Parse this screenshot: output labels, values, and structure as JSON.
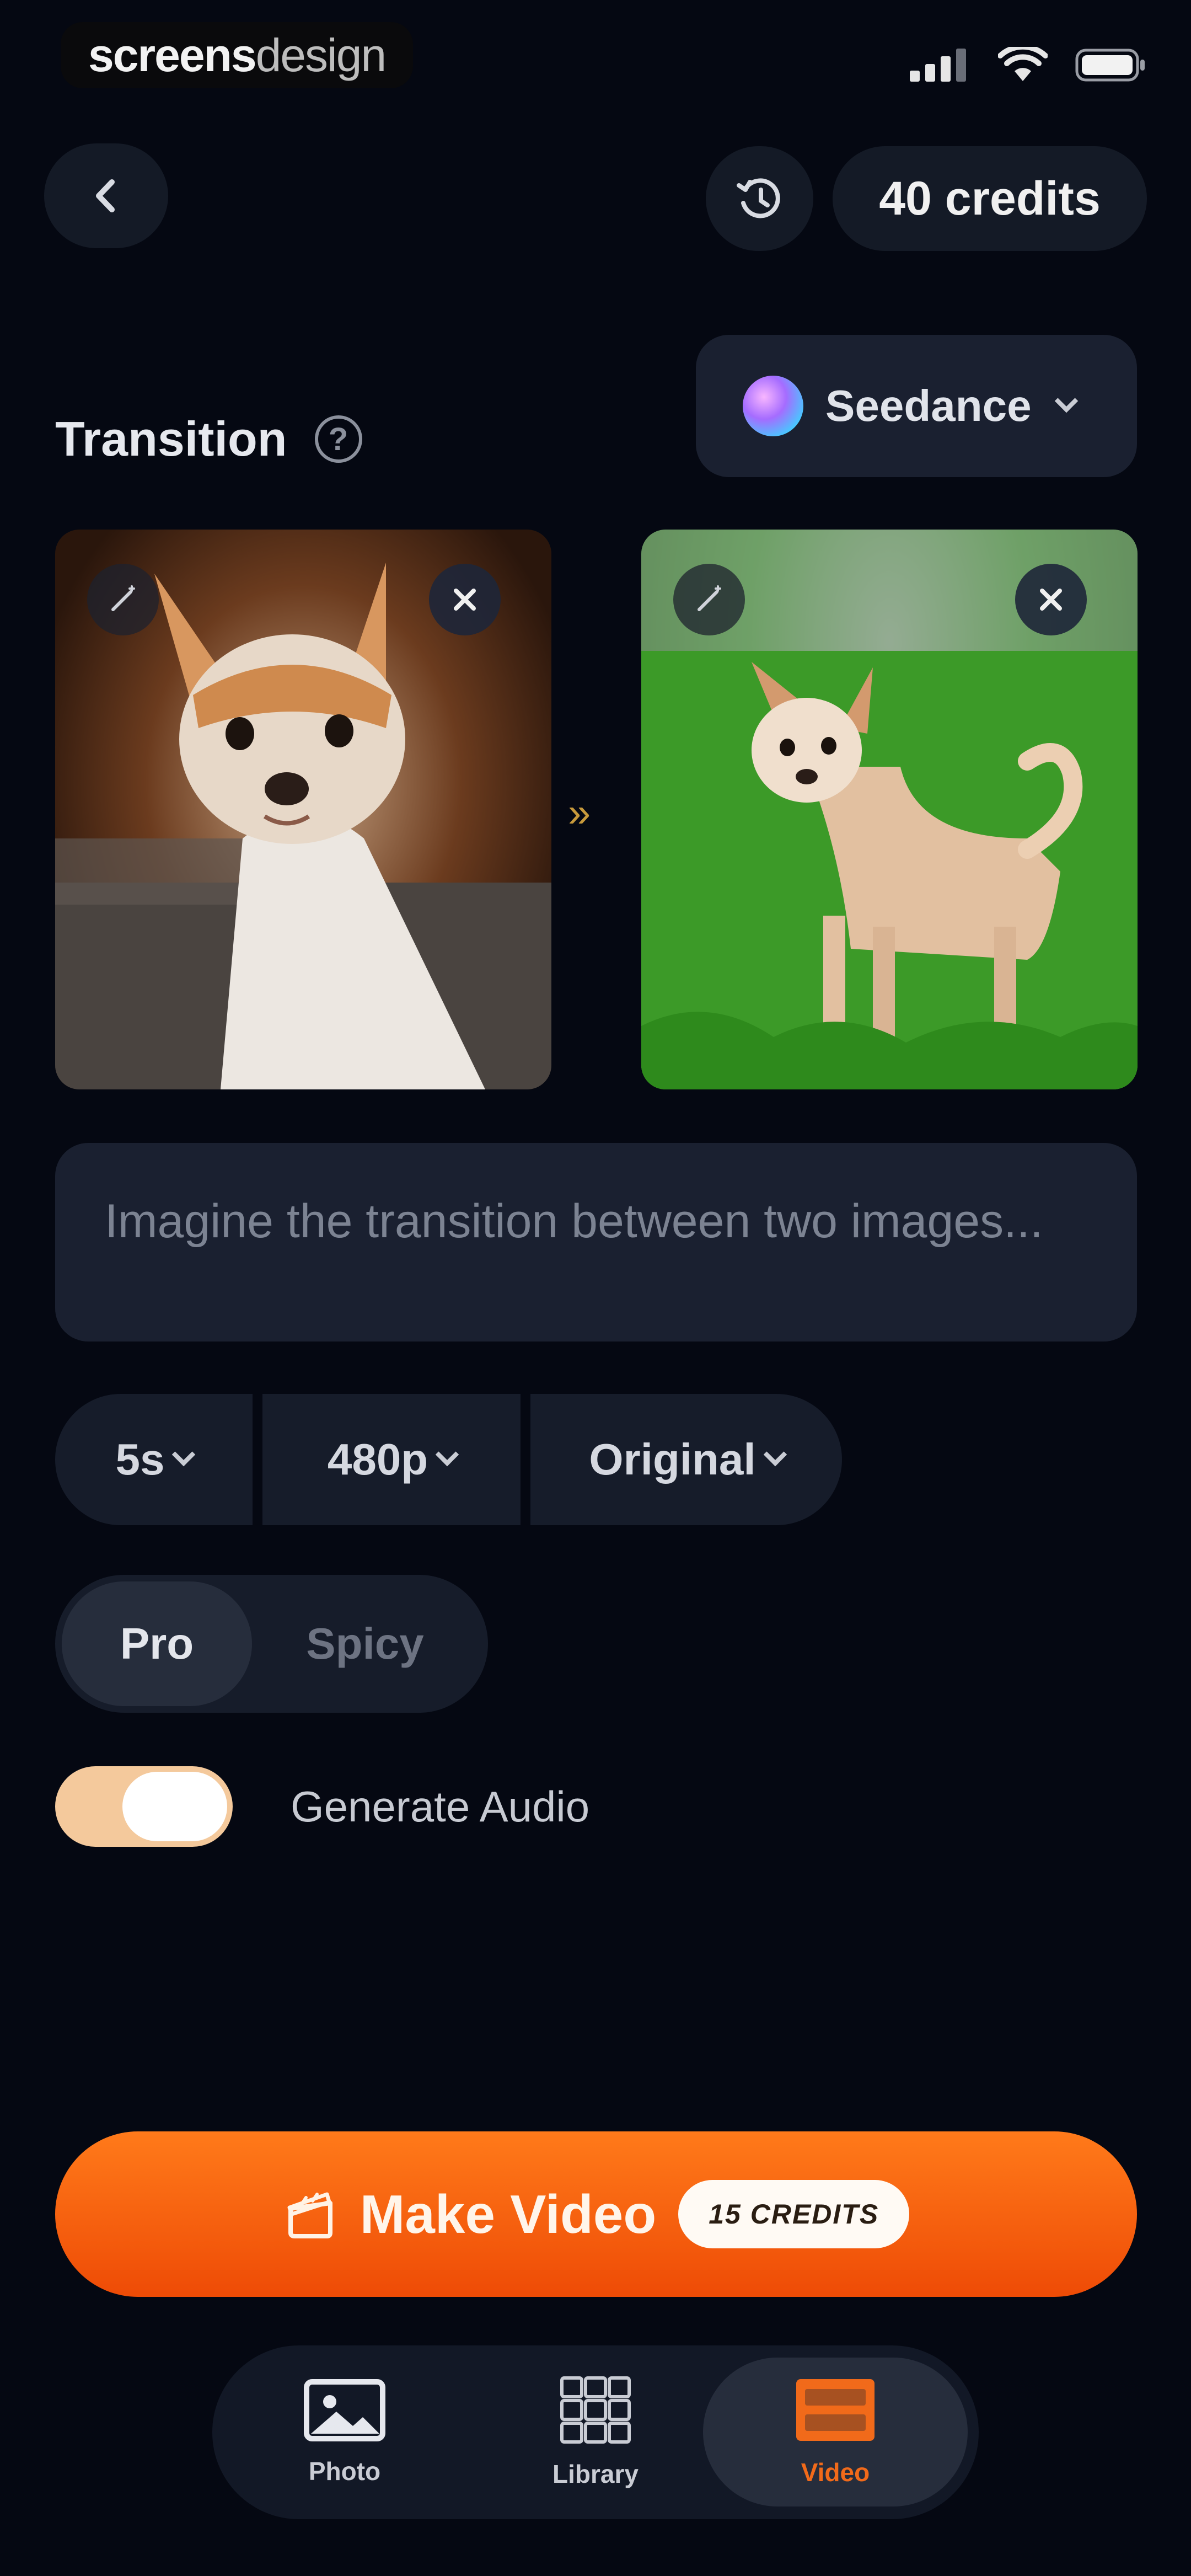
{
  "status_bar": {
    "brand_bold": "screens",
    "brand_light": "design",
    "icons": [
      "signal-icon",
      "wifi-icon",
      "battery-icon"
    ]
  },
  "header": {
    "back_icon": "chevron-left-icon",
    "history_icon": "history-icon",
    "credits_label": "40 credits"
  },
  "section": {
    "title": "Transition",
    "help_icon": "help-circle-icon",
    "help_glyph": "?"
  },
  "model_selector": {
    "label": "Seedance",
    "icon": "seedance-orb-icon"
  },
  "images": [
    {
      "subject": "Chihuahua portrait",
      "remove_icon": "close-icon",
      "edit_icon": "magic-wand-icon"
    },
    {
      "subject": "Chihuahua on grass",
      "remove_icon": "close-icon",
      "edit_icon": "magic-wand-icon"
    }
  ],
  "transition_arrow": "»",
  "prompt": {
    "placeholder": "Imagine the transition between two images..."
  },
  "options": {
    "duration": "5s",
    "resolution": "480p",
    "aspect": "Original"
  },
  "mode": {
    "selected": "Pro",
    "options": [
      "Pro",
      "Spicy"
    ]
  },
  "audio": {
    "label": "Generate Audio",
    "enabled": true
  },
  "make_video": {
    "label": "Make Video",
    "cost_label": "15 CREDITS",
    "icon": "clapperboard-icon"
  },
  "tabs": [
    {
      "label": "Photo",
      "icon": "image-icon",
      "active": false
    },
    {
      "label": "Library",
      "icon": "grid-icon",
      "active": false
    },
    {
      "label": "Video",
      "icon": "video-icon",
      "active": true
    }
  ],
  "colors": {
    "background": "#050812",
    "surface": "#1a2030",
    "accent": "#ee4b06",
    "toggle_on": "#f4c99c"
  }
}
